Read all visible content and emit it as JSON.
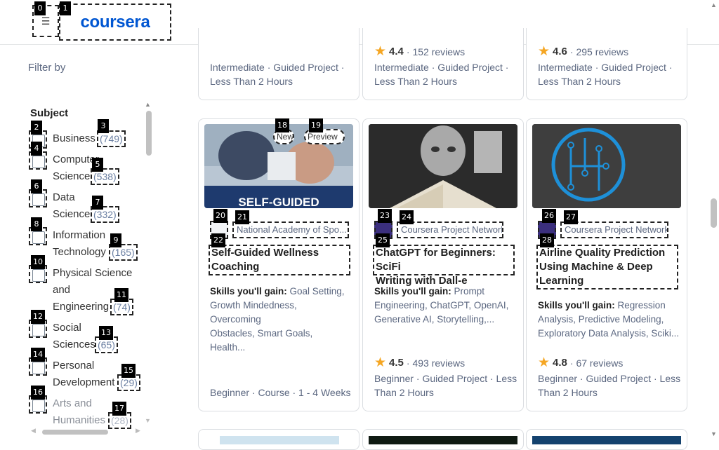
{
  "header": {
    "logo_text": "coursera",
    "menu_icon": "hamburger-icon"
  },
  "badges": [
    "0",
    "1",
    "2",
    "3",
    "4",
    "5",
    "6",
    "7",
    "8",
    "9",
    "10",
    "11",
    "12",
    "13",
    "14",
    "15",
    "16",
    "17",
    "18",
    "19",
    "20",
    "21",
    "22",
    "23",
    "24",
    "25",
    "26",
    "27",
    "28"
  ],
  "sidebar": {
    "filter_by": "Filter by",
    "subject_heading": "Subject",
    "options": [
      {
        "line1": "Business",
        "line2": "",
        "line3": "",
        "count": "(749)"
      },
      {
        "line1": "Computer",
        "line2": "Science",
        "line3": "",
        "count": "(538)"
      },
      {
        "line1": "Data",
        "line2": "Science",
        "line3": "",
        "count": "(332)"
      },
      {
        "line1": "Information",
        "line2": "Technology",
        "line3": "",
        "count": "(165)"
      },
      {
        "line1": "Physical Science",
        "line2": "and",
        "line3": "Engineering",
        "count": "(74)"
      },
      {
        "line1": "Social",
        "line2": "Sciences",
        "line3": "",
        "count": "(65)"
      },
      {
        "line1": "Personal",
        "line2": "Development",
        "line3": "",
        "count": "(29)"
      },
      {
        "line1": "Arts and",
        "line2": "Humanities",
        "line3": "",
        "count": "(28)"
      }
    ]
  },
  "top_cards": [
    {
      "rating": "",
      "reviews": "",
      "meta1": "Intermediate · Guided Project ·",
      "meta2": "Less Than 2 Hours"
    },
    {
      "rating": "4.4",
      "reviews": "152 reviews",
      "meta1": "Intermediate · Guided Project ·",
      "meta2": "Less Than 2 Hours"
    },
    {
      "rating": "4.6",
      "reviews": "295 reviews",
      "meta1": "Intermediate · Guided Project ·",
      "meta2": "Less Than 2 Hours"
    }
  ],
  "cards": [
    {
      "pill_new": "New",
      "pill_preview": "Preview",
      "thumb_text": "SELF-GUIDED",
      "partner": "National Academy of Spo...",
      "title_line1": "Self-Guided Wellness",
      "title_line2": "Coaching",
      "title_line3": "",
      "skills_label": "Skills you'll gain:",
      "skills_line1": "Goal Setting,",
      "skills_line2": "Growth Mindedness, Overcoming",
      "skills_line3": "Obstacles, Smart Goals, Health...",
      "rating": "",
      "reviews": "",
      "meta1": "Beginner · Course · 1 - 4 Weeks",
      "meta2": ""
    },
    {
      "partner": "Coursera Project Network",
      "title_line1": "ChatGPT for Beginners: SciFi",
      "title_line2": "Writing with Dall-e",
      "title_line3": "",
      "skills_label": "Skills you'll gain:",
      "skills_line1": "Prompt",
      "skills_line2": "Engineering, ChatGPT, OpenAI,",
      "skills_line3": "Generative AI, Storytelling,...",
      "rating": "4.5",
      "reviews": "493 reviews",
      "meta1": "Beginner · Guided Project · Less",
      "meta2": "Than 2 Hours"
    },
    {
      "partner": "Coursera Project Network",
      "title_line1": "Airline Quality Prediction",
      "title_line2": "Using Machine & Deep",
      "title_line3": "Learning",
      "skills_label": "Skills you'll gain:",
      "skills_line1": "Regression",
      "skills_line2": "Analysis, Predictive Modeling,",
      "skills_line3": "Exploratory Data Analysis, Sciki...",
      "rating": "4.8",
      "reviews": "67 reviews",
      "meta1": "Beginner · Guided Project · Less",
      "meta2": "Than 2 Hours"
    }
  ],
  "colors": {
    "brand": "#0056d2",
    "star": "#f5a623"
  }
}
